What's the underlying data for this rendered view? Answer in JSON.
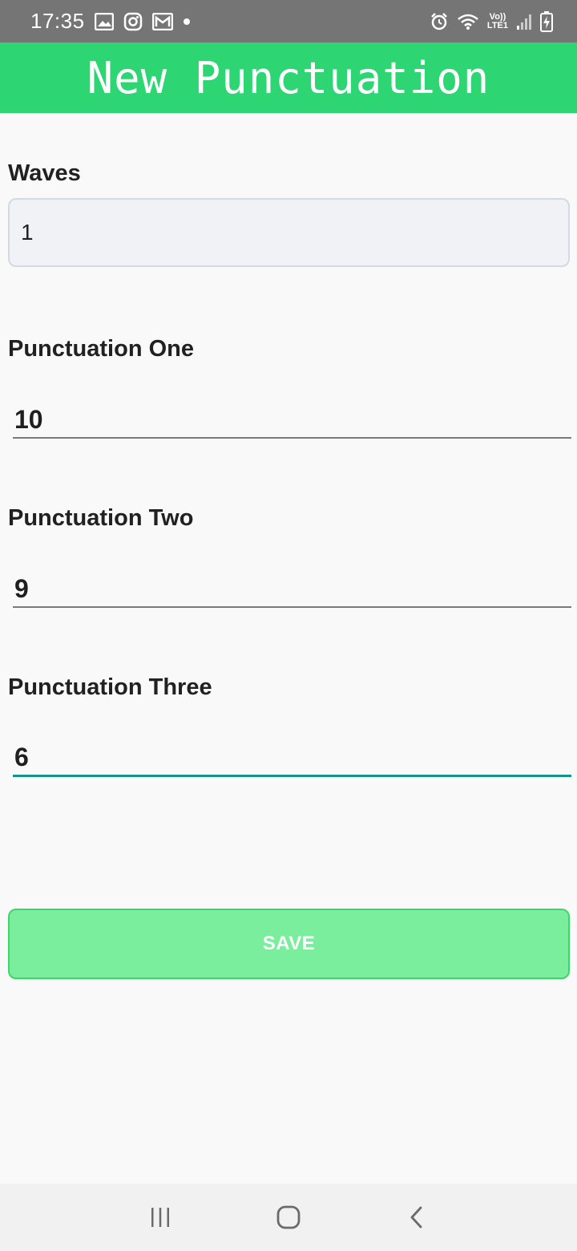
{
  "status_bar": {
    "time": "17:35",
    "notification_icons": [
      "gallery-icon",
      "instagram-icon",
      "gmail-icon",
      "dot-icon"
    ],
    "network_label_top": "Vo))",
    "network_label_bottom": "LTE1",
    "system_icons": [
      "alarm-icon",
      "wifi-icon",
      "signal-icon",
      "battery-charging-icon"
    ]
  },
  "app_bar": {
    "title": "New Punctuation",
    "background": "#2ed573"
  },
  "form": {
    "waves": {
      "label": "Waves",
      "value": "1"
    },
    "punctuation_one": {
      "label": "Punctuation One",
      "value": "10"
    },
    "punctuation_two": {
      "label": "Punctuation Two",
      "value": "9"
    },
    "punctuation_three": {
      "label": "Punctuation Three",
      "value": "6"
    },
    "focus_color": "#159488"
  },
  "save_button": {
    "label": "SAVE",
    "background": "#7bee9d"
  },
  "nav_bar": {
    "buttons": [
      "recents-icon",
      "home-icon",
      "back-icon"
    ]
  }
}
